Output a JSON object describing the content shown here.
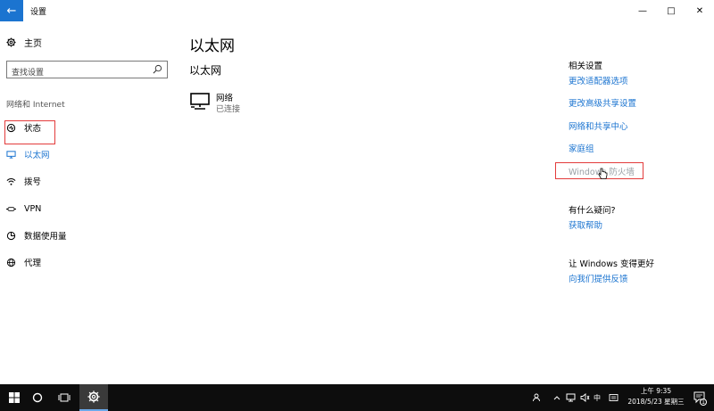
{
  "window": {
    "title": "设置",
    "back_glyph": "←",
    "controls": {
      "minimize": "—",
      "maximize": "□",
      "close": "✕"
    }
  },
  "nav": {
    "home_label": "主页",
    "search_placeholder": "查找设置",
    "section_label": "网络和 Internet",
    "items": [
      {
        "label": "状态",
        "icon": "status-icon"
      },
      {
        "label": "以太网",
        "icon": "ethernet-icon",
        "active": true
      },
      {
        "label": "拨号",
        "icon": "dialup-icon"
      },
      {
        "label": "VPN",
        "icon": "vpn-icon"
      },
      {
        "label": "数据使用量",
        "icon": "data-usage-icon"
      },
      {
        "label": "代理",
        "icon": "proxy-icon"
      }
    ]
  },
  "main": {
    "title": "以太网",
    "subtitle": "以太网",
    "network": {
      "name": "网络",
      "status": "已连接",
      "icon": "network-monitor-icon"
    }
  },
  "related": {
    "heading": "相关设置",
    "links": [
      "更改适配器选项",
      "更改高级共享设置",
      "网络和共享中心",
      "家庭组",
      "Windows 防火墙"
    ],
    "question_heading": "有什么疑问?",
    "help_link": "获取帮助",
    "feedback_heading": "让 Windows 变得更好",
    "feedback_link": "向我们提供反馈"
  },
  "taskbar": {
    "ime": "中",
    "time": "上午 9:35",
    "date": "2018/5/23 星期三",
    "notification_count": "1",
    "accent": "#1b74d0"
  }
}
